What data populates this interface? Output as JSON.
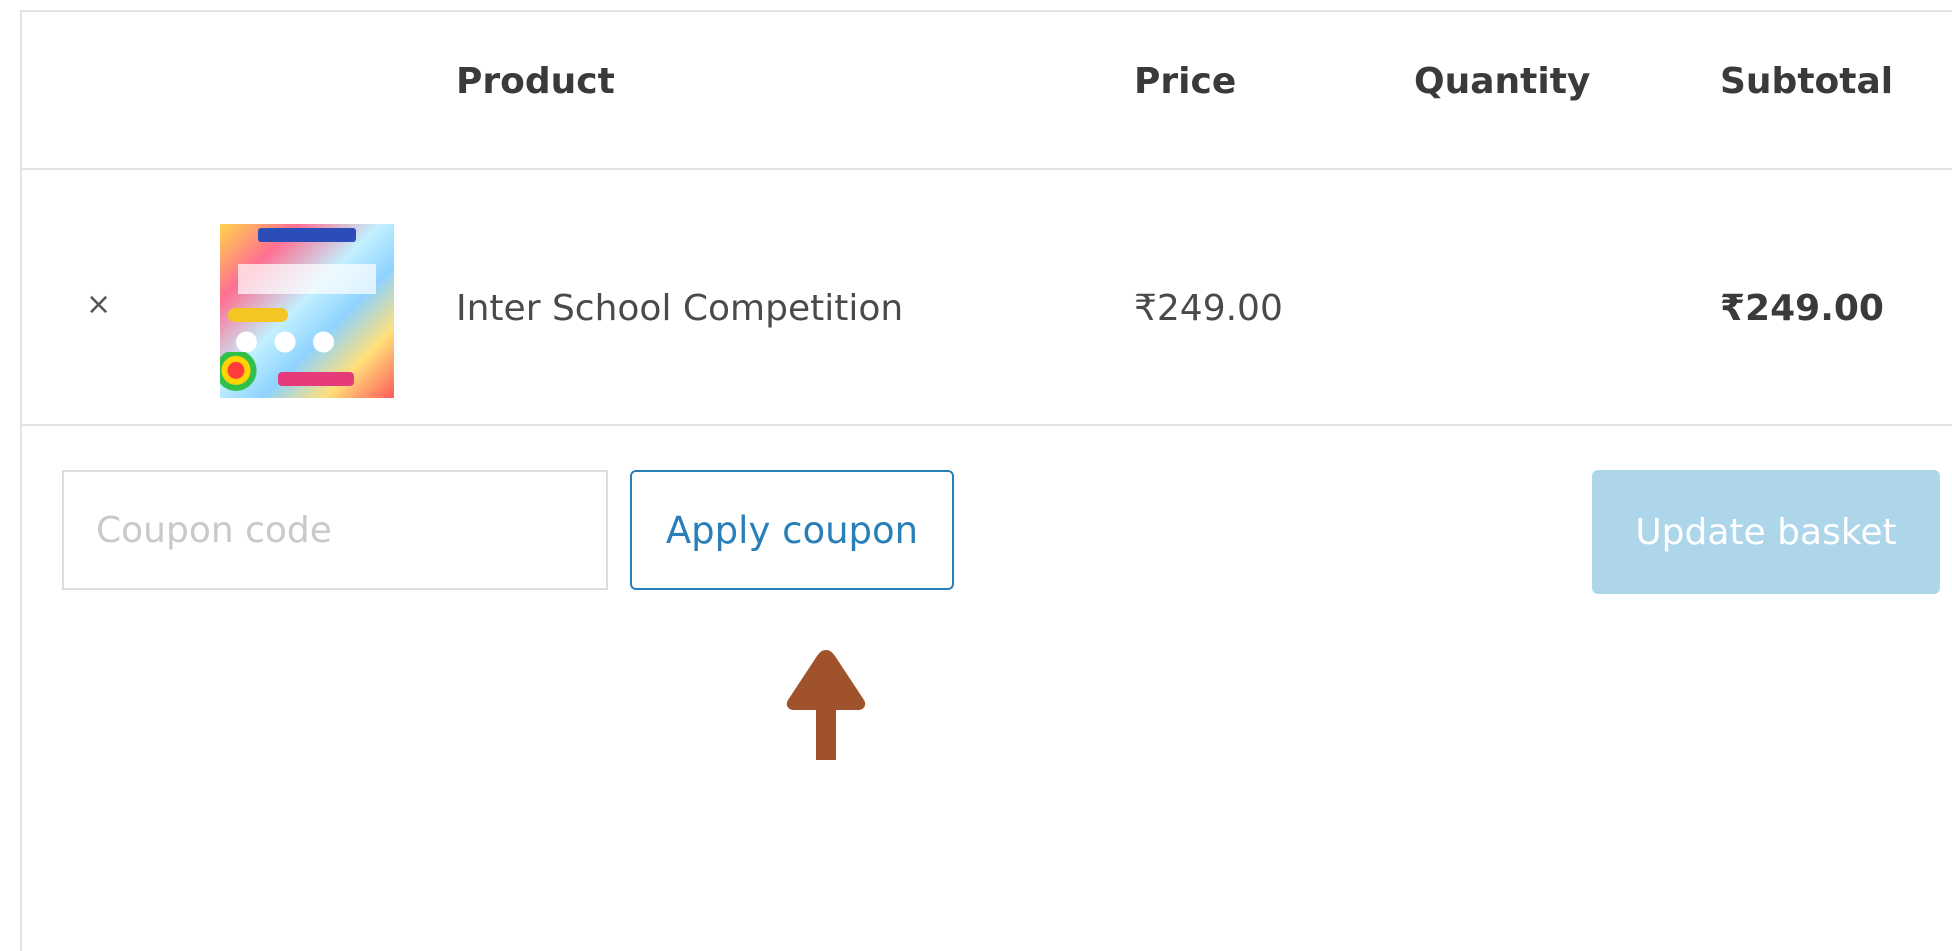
{
  "table": {
    "headers": {
      "product": "Product",
      "price": "Price",
      "quantity": "Quantity",
      "subtotal": "Subtotal"
    },
    "rows": [
      {
        "remove_icon": "×",
        "product_name": "Inter School Competition",
        "price": "₹249.00",
        "subtotal": "₹249.00"
      }
    ]
  },
  "actions": {
    "coupon_placeholder": "Coupon code",
    "apply_coupon_label": "Apply coupon",
    "update_basket_label": "Update basket"
  },
  "colors": {
    "accent": "#2a7fb8",
    "update_button_disabled": "#aed6ea",
    "pointer_arrow": "#a0522d",
    "border": "#e3e3e3"
  },
  "icons": {
    "remove": "close-icon",
    "pointer": "arrow-up-icon"
  }
}
